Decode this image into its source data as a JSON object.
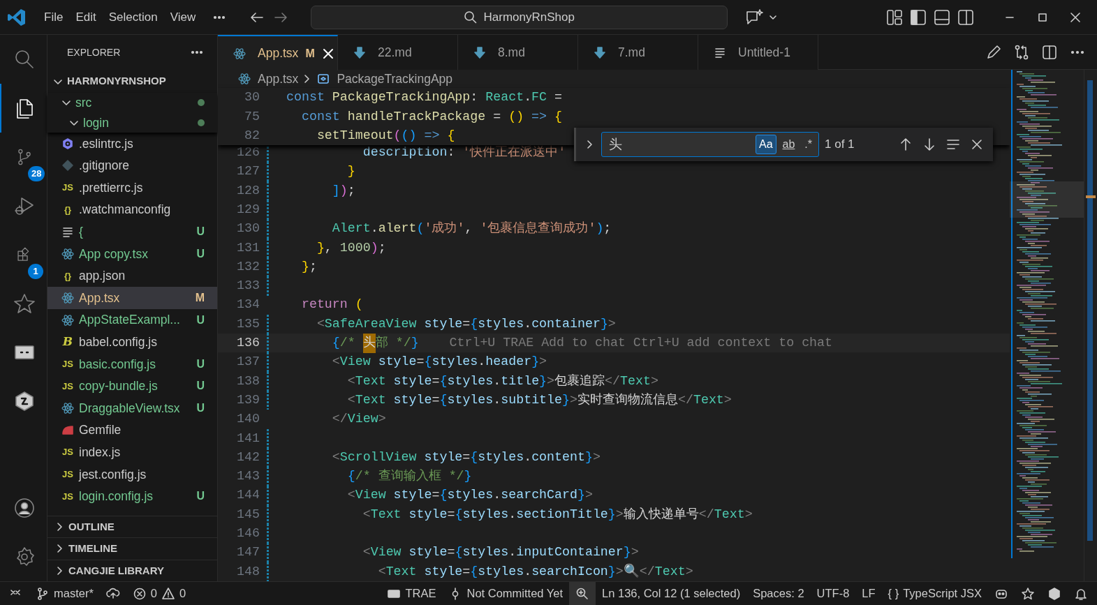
{
  "title_bar": {
    "menu": [
      {
        "label": "File"
      },
      {
        "label": "Edit"
      },
      {
        "label": "Selection"
      },
      {
        "label": "View"
      }
    ],
    "command_center": "HarmonyRnShop"
  },
  "activity_bar": [
    {
      "kind": "search",
      "selected": false
    },
    {
      "kind": "explorer",
      "selected": true
    },
    {
      "kind": "source_control",
      "selected": false,
      "badge": "28"
    },
    {
      "kind": "run_debug",
      "selected": false
    },
    {
      "kind": "extensions",
      "selected": false,
      "badge": "1"
    },
    {
      "kind": "star",
      "selected": false
    },
    {
      "kind": "screen",
      "selected": false
    },
    {
      "kind": "hexagon",
      "selected": false
    }
  ],
  "activity_bottom": [
    {
      "kind": "account"
    },
    {
      "kind": "settings"
    }
  ],
  "sidebar": {
    "title": "EXPLORER",
    "root": {
      "label": "HARMONYRNSHOP",
      "expanded": true
    },
    "sticky_folders": [
      {
        "label": "src",
        "expanded": true,
        "modified_dot": true,
        "children": [
          {
            "label": "login",
            "expanded": true,
            "modified_dot": true
          }
        ]
      }
    ],
    "files": [
      {
        "name": ".eslintrc.js",
        "kind": "eslint",
        "selected": false
      },
      {
        "name": ".gitignore",
        "kind": "git",
        "selected": false
      },
      {
        "name": ".prettierrc.js",
        "kind": "js",
        "icon_label": "JS",
        "selected": false
      },
      {
        "name": ".watchmanconfig",
        "kind": "json",
        "icon_label": "{}",
        "selected": false
      },
      {
        "name": "{",
        "kind": "text",
        "status": "U",
        "selected": false
      },
      {
        "name": "App copy.tsx",
        "kind": "react",
        "status": "U",
        "selected": false
      },
      {
        "name": "app.json",
        "kind": "json",
        "icon_label": "{}",
        "selected": false
      },
      {
        "name": "App.tsx",
        "kind": "react",
        "status": "M",
        "selected": true
      },
      {
        "name": "AppStateExampl...",
        "kind": "react",
        "status": "U",
        "selected": false
      },
      {
        "name": "babel.config.js",
        "kind": "babel",
        "icon_label": "B",
        "selected": false
      },
      {
        "name": "basic.config.js",
        "kind": "js",
        "icon_label": "JS",
        "status": "U",
        "selected": false
      },
      {
        "name": "copy-bundle.js",
        "kind": "js",
        "icon_label": "JS",
        "status": "U",
        "selected": false
      },
      {
        "name": "DraggableView.tsx",
        "kind": "react",
        "status": "U",
        "selected": false
      },
      {
        "name": "Gemfile",
        "kind": "gem",
        "selected": false
      },
      {
        "name": "index.js",
        "kind": "js",
        "icon_label": "JS",
        "selected": false
      },
      {
        "name": "jest.config.js",
        "kind": "js",
        "icon_label": "JS",
        "selected": false
      },
      {
        "name": "login.config.js",
        "kind": "js",
        "icon_label": "JS",
        "status": "U",
        "selected": false
      }
    ],
    "sections": [
      {
        "label": "OUTLINE",
        "expanded": false
      },
      {
        "label": "TIMELINE",
        "expanded": false
      },
      {
        "label": "CANGJIE LIBRARY",
        "expanded": false
      }
    ]
  },
  "tabs": [
    {
      "label": "App.tsx",
      "kind": "react",
      "status": "M",
      "selected": true
    },
    {
      "label": "22.md",
      "kind": "markdown",
      "selected": false
    },
    {
      "label": "8.md",
      "kind": "markdown",
      "selected": false
    },
    {
      "label": "7.md",
      "kind": "markdown",
      "selected": false
    },
    {
      "label": "Untitled-1",
      "kind": "text",
      "selected": false
    }
  ],
  "breadcrumb": [
    {
      "label": "App.tsx",
      "kind": "react"
    },
    {
      "label": "PackageTrackingApp",
      "kind": "symbol"
    }
  ],
  "find_widget": {
    "expanded": false,
    "value": "头",
    "options": [
      {
        "label": "Aa",
        "on": true
      },
      {
        "label": "ab",
        "on": false
      },
      {
        "label": ".*",
        "on": false
      }
    ],
    "result": "1 of 1"
  },
  "sticky_lines": [
    {
      "number": "30",
      "tokens": [
        {
          "kind": "kw",
          "text": "const "
        },
        {
          "kind": "fn",
          "text": "PackageTrackingApp"
        },
        {
          "kind": "p",
          "text": ": "
        },
        {
          "kind": "type",
          "text": "React"
        },
        {
          "kind": "p",
          "text": "."
        },
        {
          "kind": "type",
          "text": "FC"
        },
        {
          "kind": "p",
          "text": " ="
        }
      ]
    },
    {
      "number": "75",
      "tokens": [
        {
          "kind": "kw",
          "text": "  const "
        },
        {
          "kind": "fn",
          "text": "handleTrackPackage"
        },
        {
          "kind": "p",
          "text": " = "
        },
        {
          "kind": "b1",
          "text": "()"
        },
        {
          "kind": "kw",
          "text": " => "
        },
        {
          "kind": "b1",
          "text": "{"
        }
      ]
    },
    {
      "number": "82",
      "tokens": [
        {
          "kind": "fn",
          "text": "    setTimeout"
        },
        {
          "kind": "b2",
          "text": "("
        },
        {
          "kind": "b3",
          "text": "()"
        },
        {
          "kind": "kw",
          "text": " => "
        },
        {
          "kind": "b1",
          "text": "{"
        }
      ]
    }
  ],
  "lines": [
    {
      "number": "126",
      "current": false,
      "changed": true,
      "tokens": [
        {
          "kind": "var",
          "text": "          description"
        },
        {
          "kind": "p",
          "text": ": "
        },
        {
          "kind": "str",
          "text": "'快件正在派送中'"
        }
      ]
    },
    {
      "number": "127",
      "current": false,
      "changed": true,
      "tokens": [
        {
          "kind": "b1",
          "text": "        }"
        }
      ]
    },
    {
      "number": "128",
      "current": false,
      "changed": true,
      "tokens": [
        {
          "kind": "b3",
          "text": "      ]"
        },
        {
          "kind": "b2",
          "text": ")"
        },
        {
          "kind": "p",
          "text": ";"
        }
      ]
    },
    {
      "number": "129",
      "current": false,
      "changed": true
    },
    {
      "number": "130",
      "current": false,
      "changed": true,
      "tokens": [
        {
          "kind": "type",
          "text": "      Alert"
        },
        {
          "kind": "p",
          "text": "."
        },
        {
          "kind": "fn",
          "text": "alert"
        },
        {
          "kind": "b3",
          "text": "("
        },
        {
          "kind": "str",
          "text": "'成功'"
        },
        {
          "kind": "p",
          "text": ", "
        },
        {
          "kind": "str",
          "text": "'包裹信息查询成功'"
        },
        {
          "kind": "b3",
          "text": ")"
        },
        {
          "kind": "p",
          "text": ";"
        }
      ]
    },
    {
      "number": "131",
      "current": false,
      "changed": true,
      "tokens": [
        {
          "kind": "b1",
          "text": "    }"
        },
        {
          "kind": "p",
          "text": ", "
        },
        {
          "kind": "num",
          "text": "1000"
        },
        {
          "kind": "b2",
          "text": ")"
        },
        {
          "kind": "p",
          "text": ";"
        }
      ]
    },
    {
      "number": "132",
      "current": false,
      "changed": true,
      "tokens": [
        {
          "kind": "b1",
          "text": "  }"
        },
        {
          "kind": "p",
          "text": ";"
        }
      ]
    },
    {
      "number": "133",
      "current": false,
      "changed": true
    },
    {
      "number": "134",
      "current": false,
      "changed": false,
      "tokens": [
        {
          "kind": "ctl",
          "text": "  return "
        },
        {
          "kind": "b1",
          "text": "("
        }
      ]
    },
    {
      "number": "135",
      "current": false,
      "changed": true,
      "tokens": [
        {
          "kind": "ang",
          "text": "    <"
        },
        {
          "kind": "type",
          "text": "SafeAreaView"
        },
        {
          "kind": "var",
          "text": " style"
        },
        {
          "kind": "p",
          "text": "="
        },
        {
          "kind": "b3",
          "text": "{"
        },
        {
          "kind": "var",
          "text": "styles"
        },
        {
          "kind": "p",
          "text": "."
        },
        {
          "kind": "var",
          "text": "container"
        },
        {
          "kind": "b3",
          "text": "}"
        },
        {
          "kind": "ang",
          "text": ">"
        }
      ]
    },
    {
      "number": "136",
      "current": true,
      "changed": true,
      "tokens": [
        {
          "kind": "b3",
          "text": "      {"
        },
        {
          "kind": "cmt",
          "text": "/* "
        },
        {
          "kind": "match",
          "text": "头"
        },
        {
          "kind": "cmt",
          "text": "部 */"
        },
        {
          "kind": "b3",
          "text": "}"
        },
        {
          "kind": "hint",
          "text": "    Ctrl+U TRAE Add to chat Ctrl+U add context to chat"
        }
      ]
    },
    {
      "number": "137",
      "current": false,
      "changed": true,
      "tokens": [
        {
          "kind": "ang",
          "text": "      <"
        },
        {
          "kind": "type",
          "text": "View"
        },
        {
          "kind": "var",
          "text": " style"
        },
        {
          "kind": "p",
          "text": "="
        },
        {
          "kind": "b3",
          "text": "{"
        },
        {
          "kind": "var",
          "text": "styles"
        },
        {
          "kind": "p",
          "text": "."
        },
        {
          "kind": "var",
          "text": "header"
        },
        {
          "kind": "b3",
          "text": "}"
        },
        {
          "kind": "ang",
          "text": ">"
        }
      ]
    },
    {
      "number": "138",
      "current": false,
      "changed": true,
      "tokens": [
        {
          "kind": "ang",
          "text": "        <"
        },
        {
          "kind": "type",
          "text": "Text"
        },
        {
          "kind": "var",
          "text": " style"
        },
        {
          "kind": "p",
          "text": "="
        },
        {
          "kind": "b3",
          "text": "{"
        },
        {
          "kind": "var",
          "text": "styles"
        },
        {
          "kind": "p",
          "text": "."
        },
        {
          "kind": "var",
          "text": "title"
        },
        {
          "kind": "b3",
          "text": "}"
        },
        {
          "kind": "ang",
          "text": ">"
        },
        {
          "kind": "p",
          "text": "包裹追踪"
        },
        {
          "kind": "ang",
          "text": "</"
        },
        {
          "kind": "type",
          "text": "Text"
        },
        {
          "kind": "ang",
          "text": ">"
        }
      ]
    },
    {
      "number": "139",
      "current": false,
      "changed": true,
      "tokens": [
        {
          "kind": "ang",
          "text": "        <"
        },
        {
          "kind": "type",
          "text": "Text"
        },
        {
          "kind": "var",
          "text": " style"
        },
        {
          "kind": "p",
          "text": "="
        },
        {
          "kind": "b3",
          "text": "{"
        },
        {
          "kind": "var",
          "text": "styles"
        },
        {
          "kind": "p",
          "text": "."
        },
        {
          "kind": "var",
          "text": "subtitle"
        },
        {
          "kind": "b3",
          "text": "}"
        },
        {
          "kind": "ang",
          "text": ">"
        },
        {
          "kind": "p",
          "text": "实时查询物流信息"
        },
        {
          "kind": "ang",
          "text": "</"
        },
        {
          "kind": "type",
          "text": "Text"
        },
        {
          "kind": "ang",
          "text": ">"
        }
      ]
    },
    {
      "number": "140",
      "current": false,
      "changed": false,
      "tokens": [
        {
          "kind": "ang",
          "text": "      </"
        },
        {
          "kind": "type",
          "text": "View"
        },
        {
          "kind": "ang",
          "text": ">"
        }
      ]
    },
    {
      "number": "141",
      "current": false,
      "changed": true
    },
    {
      "number": "142",
      "current": false,
      "changed": true,
      "tokens": [
        {
          "kind": "ang",
          "text": "      <"
        },
        {
          "kind": "type",
          "text": "ScrollView"
        },
        {
          "kind": "var",
          "text": " style"
        },
        {
          "kind": "p",
          "text": "="
        },
        {
          "kind": "b3",
          "text": "{"
        },
        {
          "kind": "var",
          "text": "styles"
        },
        {
          "kind": "p",
          "text": "."
        },
        {
          "kind": "var",
          "text": "content"
        },
        {
          "kind": "b3",
          "text": "}"
        },
        {
          "kind": "ang",
          "text": ">"
        }
      ]
    },
    {
      "number": "143",
      "current": false,
      "changed": true,
      "tokens": [
        {
          "kind": "b3",
          "text": "        {"
        },
        {
          "kind": "cmt",
          "text": "/* 查询输入框 */"
        },
        {
          "kind": "b3",
          "text": "}"
        }
      ]
    },
    {
      "number": "144",
      "current": false,
      "changed": true,
      "tokens": [
        {
          "kind": "ang",
          "text": "        <"
        },
        {
          "kind": "type",
          "text": "View"
        },
        {
          "kind": "var",
          "text": " style"
        },
        {
          "kind": "p",
          "text": "="
        },
        {
          "kind": "b3",
          "text": "{"
        },
        {
          "kind": "var",
          "text": "styles"
        },
        {
          "kind": "p",
          "text": "."
        },
        {
          "kind": "var",
          "text": "searchCard"
        },
        {
          "kind": "b3",
          "text": "}"
        },
        {
          "kind": "ang",
          "text": ">"
        }
      ]
    },
    {
      "number": "145",
      "current": false,
      "changed": true,
      "tokens": [
        {
          "kind": "ang",
          "text": "          <"
        },
        {
          "kind": "type",
          "text": "Text"
        },
        {
          "kind": "var",
          "text": " style"
        },
        {
          "kind": "p",
          "text": "="
        },
        {
          "kind": "b3",
          "text": "{"
        },
        {
          "kind": "var",
          "text": "styles"
        },
        {
          "kind": "p",
          "text": "."
        },
        {
          "kind": "var",
          "text": "sectionTitle"
        },
        {
          "kind": "b3",
          "text": "}"
        },
        {
          "kind": "ang",
          "text": ">"
        },
        {
          "kind": "p",
          "text": "输入快递单号"
        },
        {
          "kind": "ang",
          "text": "</"
        },
        {
          "kind": "type",
          "text": "Text"
        },
        {
          "kind": "ang",
          "text": ">"
        }
      ]
    },
    {
      "number": "146",
      "current": false,
      "changed": true
    },
    {
      "number": "147",
      "current": false,
      "changed": true,
      "tokens": [
        {
          "kind": "ang",
          "text": "          <"
        },
        {
          "kind": "type",
          "text": "View"
        },
        {
          "kind": "var",
          "text": " style"
        },
        {
          "kind": "p",
          "text": "="
        },
        {
          "kind": "b3",
          "text": "{"
        },
        {
          "kind": "var",
          "text": "styles"
        },
        {
          "kind": "p",
          "text": "."
        },
        {
          "kind": "var",
          "text": "inputContainer"
        },
        {
          "kind": "b3",
          "text": "}"
        },
        {
          "kind": "ang",
          "text": ">"
        }
      ]
    },
    {
      "number": "148",
      "current": false,
      "changed": true,
      "tokens": [
        {
          "kind": "ang",
          "text": "            <"
        },
        {
          "kind": "type",
          "text": "Text"
        },
        {
          "kind": "var",
          "text": " style"
        },
        {
          "kind": "p",
          "text": "="
        },
        {
          "kind": "b3",
          "text": "{"
        },
        {
          "kind": "var",
          "text": "styles"
        },
        {
          "kind": "p",
          "text": "."
        },
        {
          "kind": "var",
          "text": "searchIcon"
        },
        {
          "kind": "b3",
          "text": "}"
        },
        {
          "kind": "ang",
          "text": ">"
        },
        {
          "kind": "p",
          "text": "🔍"
        },
        {
          "kind": "ang",
          "text": "</"
        },
        {
          "kind": "type",
          "text": "Text"
        },
        {
          "kind": "ang",
          "text": ">"
        }
      ]
    }
  ],
  "status_bar": {
    "left": [
      {
        "kind": "remote"
      },
      {
        "kind": "branch",
        "text": "master*"
      },
      {
        "kind": "sync"
      },
      {
        "kind": "problems",
        "errors": "0",
        "warnings": "0"
      }
    ],
    "right": [
      {
        "kind": "trae",
        "text": "TRAE"
      },
      {
        "kind": "commit",
        "text": "Not Committed Yet"
      },
      {
        "kind": "zoom",
        "highlighted": true
      },
      {
        "kind": "text",
        "text": "Ln 136, Col 12 (1 selected)"
      },
      {
        "kind": "text",
        "text": "Spaces: 2"
      },
      {
        "kind": "text",
        "text": "UTF-8"
      },
      {
        "kind": "text",
        "text": "LF"
      },
      {
        "kind": "language",
        "icon_label": "{ }",
        "text": "TypeScript JSX"
      },
      {
        "kind": "copilot"
      },
      {
        "kind": "star"
      },
      {
        "kind": "hexagon"
      },
      {
        "kind": "bell"
      }
    ]
  }
}
